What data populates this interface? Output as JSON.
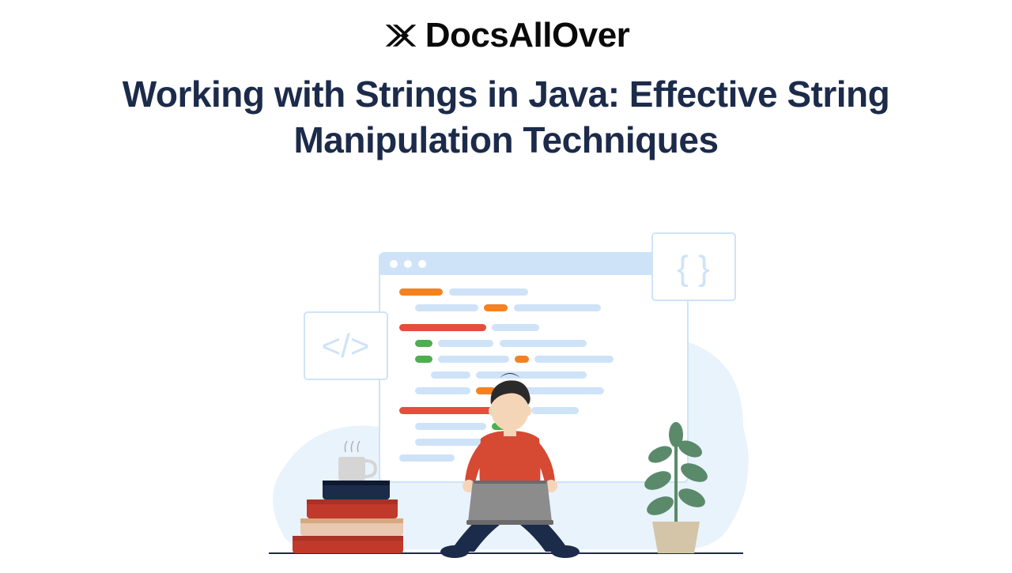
{
  "brand": {
    "name": "DocsAllOver",
    "icon": "double-x-icon"
  },
  "title": "Working with Strings in Java: Effective String Manipulation Techniques",
  "illustration": {
    "description": "programmer-with-laptop-code-window-books-plant",
    "badges": {
      "left": "</>",
      "right": "{ }"
    }
  },
  "colors": {
    "text_dark": "#1c2b4a",
    "black": "#0a0a0a",
    "light_blue": "#cfe3f8",
    "pale_blue": "#e9f3fc",
    "orange": "#f5821f",
    "red": "#e74c3c",
    "green": "#4caf50",
    "dark_red": "#c0392b",
    "navy": "#1c2b4a",
    "gray": "#7a7a7a",
    "skin": "#f5d5b8",
    "hair": "#2a2a2a",
    "shirt": "#d64933",
    "pants": "#1c2b4a",
    "laptop": "#8c8c8c",
    "plant_green": "#5a8a6a",
    "pot": "#d4c5a8"
  }
}
